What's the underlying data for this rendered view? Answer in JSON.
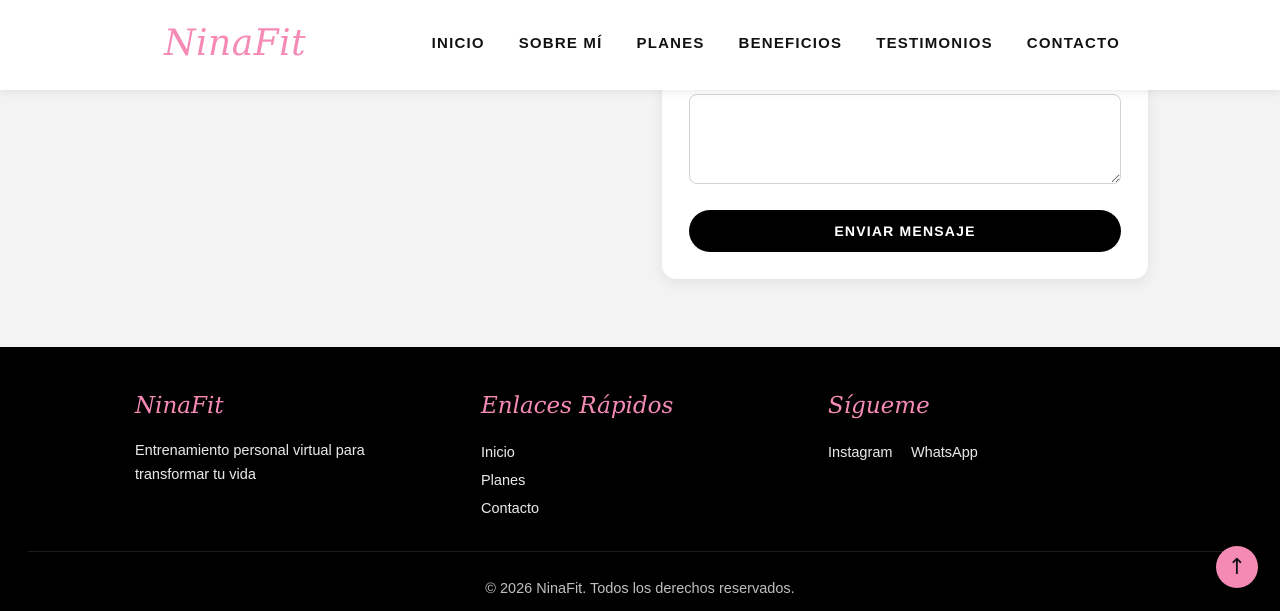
{
  "header": {
    "logo": "NinaFit",
    "nav": [
      "INICIO",
      "SOBRE MÍ",
      "PLANES",
      "BENEFICIOS",
      "TESTIMONIOS",
      "CONTACTO"
    ]
  },
  "contact_form": {
    "message_value": "",
    "submit_label": "ENVIAR MENSAJE"
  },
  "footer": {
    "brand": {
      "title": "NinaFit",
      "description": "Entrenamiento personal virtual para transformar tu vida"
    },
    "quick_links": {
      "title": "Enlaces Rápidos",
      "items": [
        "Inicio",
        "Planes",
        "Contacto"
      ]
    },
    "social": {
      "title": "Sígueme",
      "items": [
        "Instagram",
        "WhatsApp"
      ]
    },
    "copyright": "© 2026 NinaFit. Todos los derechos reservados."
  },
  "back_to_top": {
    "icon": "arrow-up-icon",
    "glyph": "↑"
  },
  "colors": {
    "accent_pink": "#f58ab5",
    "footer_bg": "#000000",
    "page_bg": "#f3f3f3"
  }
}
